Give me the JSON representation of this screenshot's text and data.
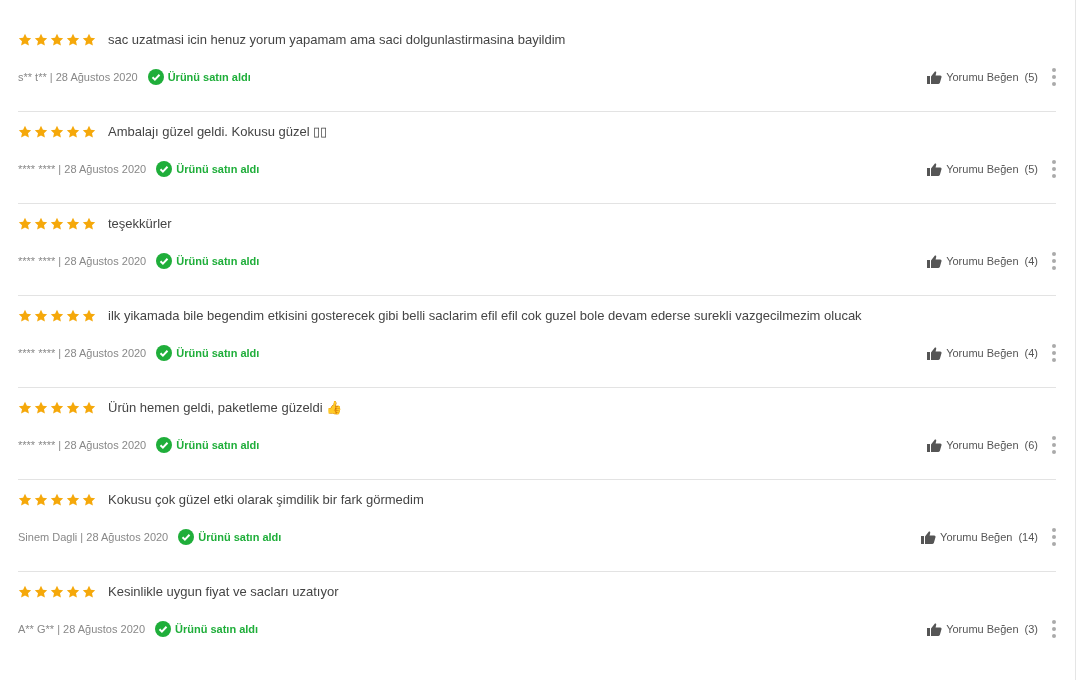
{
  "reviews": [
    {
      "stars": 5,
      "text": "sac uzatmasi icin henuz yorum yapamam ama saci dolgunlastirmasina bayildim",
      "meta": "s** t** | 28 Ağustos 2020",
      "verified": true,
      "verified_label": "Ürünü satın aldı",
      "like_label": "Yorumu Beğen",
      "like_count": "(5)"
    },
    {
      "stars": 5,
      "text": "Ambalajı güzel geldi. Kokusu güzel ▯▯",
      "meta": "**** **** | 28 Ağustos 2020",
      "verified": true,
      "verified_label": "Ürünü satın aldı",
      "like_label": "Yorumu Beğen",
      "like_count": "(5)"
    },
    {
      "stars": 5,
      "text": "teşekkürler",
      "meta": "**** **** | 28 Ağustos 2020",
      "verified": true,
      "verified_label": "Ürünü satın aldı",
      "like_label": "Yorumu Beğen",
      "like_count": "(4)"
    },
    {
      "stars": 5,
      "text": "ilk yikamada bile begendim etkisini gosterecek gibi belli saclarim efil efil cok guzel bole devam ederse surekli vazgecilmezim olucak",
      "meta": "**** **** | 28 Ağustos 2020",
      "verified": true,
      "verified_label": "Ürünü satın aldı",
      "like_label": "Yorumu Beğen",
      "like_count": "(4)"
    },
    {
      "stars": 5,
      "text": "Ürün hemen geldi, paketleme güzeldi 👍",
      "meta": "**** **** | 28 Ağustos 2020",
      "verified": true,
      "verified_label": "Ürünü satın aldı",
      "like_label": "Yorumu Beğen",
      "like_count": "(6)"
    },
    {
      "stars": 5,
      "text": "Kokusu çok güzel etki olarak şimdilik bir fark görmedim",
      "meta": "Sinem Dagli | 28 Ağustos 2020",
      "verified": true,
      "verified_label": "Ürünü satın aldı",
      "like_label": "Yorumu Beğen",
      "like_count": "(14)"
    },
    {
      "stars": 5,
      "text": "Kesinlikle uygun fiyat ve sacları uzatıyor",
      "meta": "A** G** | 28 Ağustos 2020",
      "verified": true,
      "verified_label": "Ürünü satın aldı",
      "like_label": "Yorumu Beğen",
      "like_count": "(3)"
    }
  ]
}
